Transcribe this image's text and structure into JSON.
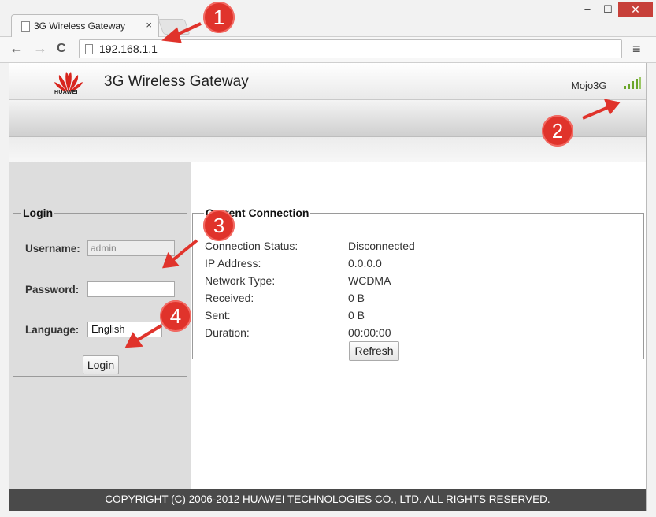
{
  "browser": {
    "tab_title": "3G Wireless Gateway",
    "tab_close": "×",
    "url": "192.168.1.1",
    "window_minimize": "–",
    "window_maximize": "☐",
    "window_close": "✕",
    "back": "←",
    "forward": "→",
    "reload": "C",
    "menu": "≡"
  },
  "header": {
    "logo_text": "HUAWEI",
    "title": "3G Wireless Gateway",
    "carrier": "Mojo3G"
  },
  "login": {
    "legend": "Login",
    "username_label": "Username:",
    "username_value": "admin",
    "password_label": "Password:",
    "password_value": "",
    "language_label": "Language:",
    "language_value": "English",
    "login_button": "Login"
  },
  "connection": {
    "legend": "Current Connection",
    "rows": [
      {
        "label": "Connection Status:",
        "value": "Disconnected"
      },
      {
        "label": "IP Address:",
        "value": "0.0.0.0"
      },
      {
        "label": "Network Type:",
        "value": "WCDMA"
      },
      {
        "label": "Received:",
        "value": "0 B"
      },
      {
        "label": "Sent:",
        "value": "0 B"
      },
      {
        "label": "Duration:",
        "value": "00:00:00"
      }
    ],
    "refresh_button": "Refresh"
  },
  "footer": {
    "copyright": "COPYRIGHT (C) 2006-2012 HUAWEI TECHNOLOGIES CO., LTD. ALL RIGHTS RESERVED."
  },
  "annotations": [
    "1",
    "2",
    "3",
    "4"
  ],
  "colors": {
    "annotation_red": "#e0332b",
    "signal_green": "#6aa52a",
    "footer_bg": "#4a4a4a"
  }
}
